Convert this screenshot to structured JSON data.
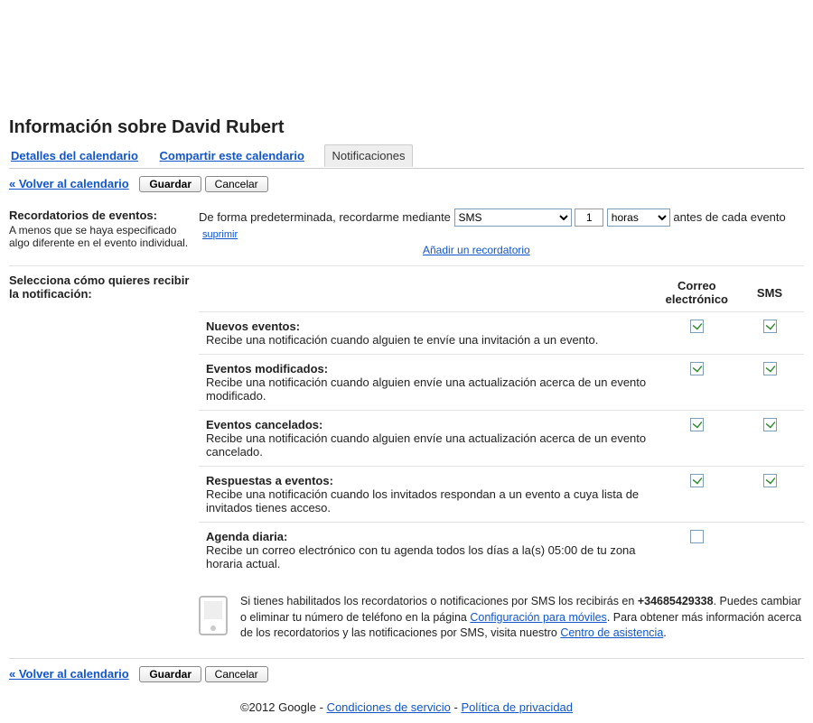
{
  "page_title": "Información sobre David Rubert",
  "tabs": {
    "details": "Detalles del calendario",
    "share": "Compartir este calendario",
    "notifications": "Notificaciones"
  },
  "actions": {
    "back": "« Volver al calendario",
    "save": "Guardar",
    "cancel": "Cancelar"
  },
  "reminders_section": {
    "label": "Recordatorios de eventos:",
    "hint": "A menos que se haya especificado algo diferente en el evento individual.",
    "lead_text": "De forma predeterminada, recordarme mediante",
    "method_selected": "SMS",
    "number": "1",
    "unit_selected": "horas",
    "trail_text": "antes de cada evento",
    "suppress": "suprimir",
    "add_link": "Añadir un recordatorio"
  },
  "notify_section": {
    "label": "Selecciona cómo quieres recibir la notificación:",
    "col_email": "Correo electrónico",
    "col_sms": "SMS",
    "rows": [
      {
        "title": "Nuevos eventos:",
        "desc": "Recibe una notificación cuando alguien te envíe una invitación a un evento.",
        "email": true,
        "sms": true
      },
      {
        "title": "Eventos modificados:",
        "desc": "Recibe una notificación cuando alguien envíe una actualización acerca de un evento modificado.",
        "email": true,
        "sms": true
      },
      {
        "title": "Eventos cancelados:",
        "desc": "Recibe una notificación cuando alguien envíe una actualización acerca de un evento cancelado.",
        "email": true,
        "sms": true
      },
      {
        "title": "Respuestas a eventos:",
        "desc": "Recibe una notificación cuando los invitados respondan a un evento a cuya lista de invitados tienes acceso.",
        "email": true,
        "sms": true
      },
      {
        "title": "Agenda diaria:",
        "desc": "Recibe un correo electrónico con tu agenda todos los días a la(s) 05:00 de tu zona horaria actual.",
        "email": false,
        "sms": null
      }
    ]
  },
  "info": {
    "part1": "Si tienes habilitados los recordatorios o notificaciones por SMS los recibirás en ",
    "phone": "+34685429338",
    "part2": ". Puedes cambiar o eliminar tu número de teléfono en la página ",
    "link1": "Configuración para móviles",
    "part3": ". Para obtener más información acerca de los recordatorios y las notificaciones por SMS, visita nuestro ",
    "link2": "Centro de asistencia",
    "part4": "."
  },
  "footer": {
    "copyright": "©2012 Google - ",
    "terms": "Condiciones de servicio",
    "sep": " - ",
    "privacy": "Política de privacidad"
  }
}
